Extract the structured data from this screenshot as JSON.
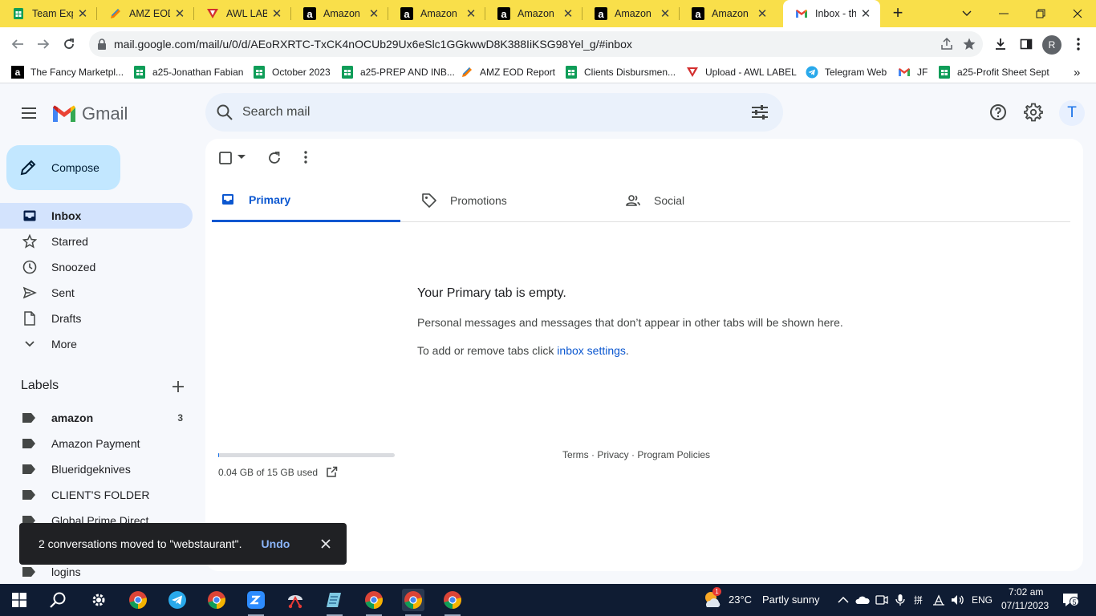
{
  "browser": {
    "tabs": [
      {
        "title": "Team Expl",
        "icon": "google-sheets-icon",
        "color": "#0f9d58"
      },
      {
        "title": "AMZ EOD",
        "icon": "pencil-logo-icon",
        "color": "#f57c00"
      },
      {
        "title": "AWL LABE",
        "icon": "awl-logo-icon",
        "color": "#d32f2f"
      },
      {
        "title": "Amazon",
        "icon": "amazon-icon",
        "color": "#000000"
      },
      {
        "title": "Amazon",
        "icon": "amazon-icon",
        "color": "#000000"
      },
      {
        "title": "Amazon",
        "icon": "amazon-icon",
        "color": "#000000"
      },
      {
        "title": "Amazon",
        "icon": "amazon-icon",
        "color": "#000000"
      },
      {
        "title": "Amazon",
        "icon": "amazon-icon",
        "color": "#000000"
      },
      {
        "title": "Inbox - th",
        "icon": "gmail-icon",
        "color": "#ea4335",
        "active": true
      }
    ],
    "close_glyph": "✕",
    "new_tab_glyph": "+",
    "url": "mail.google.com/mail/u/0/d/AEoRXRTC-TxCK4nOCUb29Ux6eSlc1GGkwwD8K388IiKSG98Yel_g/#inbox",
    "profile_letter": "R",
    "bookmarks": [
      {
        "label": "The Fancy Marketpl...",
        "icon": "amazon-icon"
      },
      {
        "label": "a25-Jonathan Fabian",
        "icon": "google-sheets-icon"
      },
      {
        "label": "October 2023",
        "icon": "google-sheets-icon"
      },
      {
        "label": "a25-PREP AND INB...",
        "icon": "google-sheets-icon"
      },
      {
        "label": "AMZ EOD Report",
        "icon": "pencil-logo-icon"
      },
      {
        "label": "Clients Disbursmen...",
        "icon": "google-sheets-icon"
      },
      {
        "label": "Upload - AWL LABEL",
        "icon": "awl-logo-icon"
      },
      {
        "label": "Telegram Web",
        "icon": "telegram-icon"
      },
      {
        "label": "JF",
        "icon": "gmail-icon"
      },
      {
        "label": "a25-Profit Sheet Sept",
        "icon": "google-sheets-icon"
      }
    ],
    "more_bookmarks": "»"
  },
  "gmail": {
    "logo_text": "Gmail",
    "search_placeholder": "Search mail",
    "account_letter": "T",
    "compose_label": "Compose",
    "nav": [
      {
        "label": "Inbox",
        "icon": "inbox-icon",
        "active": true
      },
      {
        "label": "Starred",
        "icon": "star-icon"
      },
      {
        "label": "Snoozed",
        "icon": "clock-icon"
      },
      {
        "label": "Sent",
        "icon": "send-icon"
      },
      {
        "label": "Drafts",
        "icon": "draft-icon"
      },
      {
        "label": "More",
        "icon": "chevron-down-icon"
      }
    ],
    "labels_heading": "Labels",
    "labels": [
      {
        "name": "amazon",
        "count": "3",
        "bold": true
      },
      {
        "name": "Amazon Payment",
        "count": ""
      },
      {
        "name": "Blueridgeknives",
        "count": ""
      },
      {
        "name": "CLIENT'S FOLDER",
        "count": ""
      },
      {
        "name": "Global Prime Direct",
        "count": ""
      },
      {
        "name": "logins",
        "count": ""
      }
    ],
    "tabs": [
      {
        "label": "Primary",
        "icon": "inbox-icon",
        "active": true
      },
      {
        "label": "Promotions",
        "icon": "tag-icon"
      },
      {
        "label": "Social",
        "icon": "people-icon"
      }
    ],
    "empty_heading": "Your Primary tab is empty.",
    "empty_text": "Personal messages and messages that don’t appear in other tabs will be shown here.",
    "empty_settings_prefix": "To add or remove tabs click ",
    "empty_settings_link": "inbox settings",
    "empty_settings_suffix": ".",
    "storage_used_fraction": 0.003,
    "storage_text": "0.04 GB of 15 GB used",
    "footer": "Terms · Privacy · Program Policies",
    "snackbar_message": "2 conversations moved to \"webstaurant\".",
    "snackbar_action": "Undo"
  },
  "taskbar": {
    "weather_temp": "23°C",
    "weather_desc": "Partly sunny",
    "weather_badge": "1",
    "language": "ENG",
    "time": "7:02 am",
    "date": "07/11/2023",
    "notification_count": "5"
  },
  "colors": {
    "tab_strip": "#f9df4a",
    "selected_nav": "#d3e3fd",
    "compose": "#c2e7ff",
    "primary_accent": "#0b57d0",
    "taskbar": "#0f1c33"
  }
}
